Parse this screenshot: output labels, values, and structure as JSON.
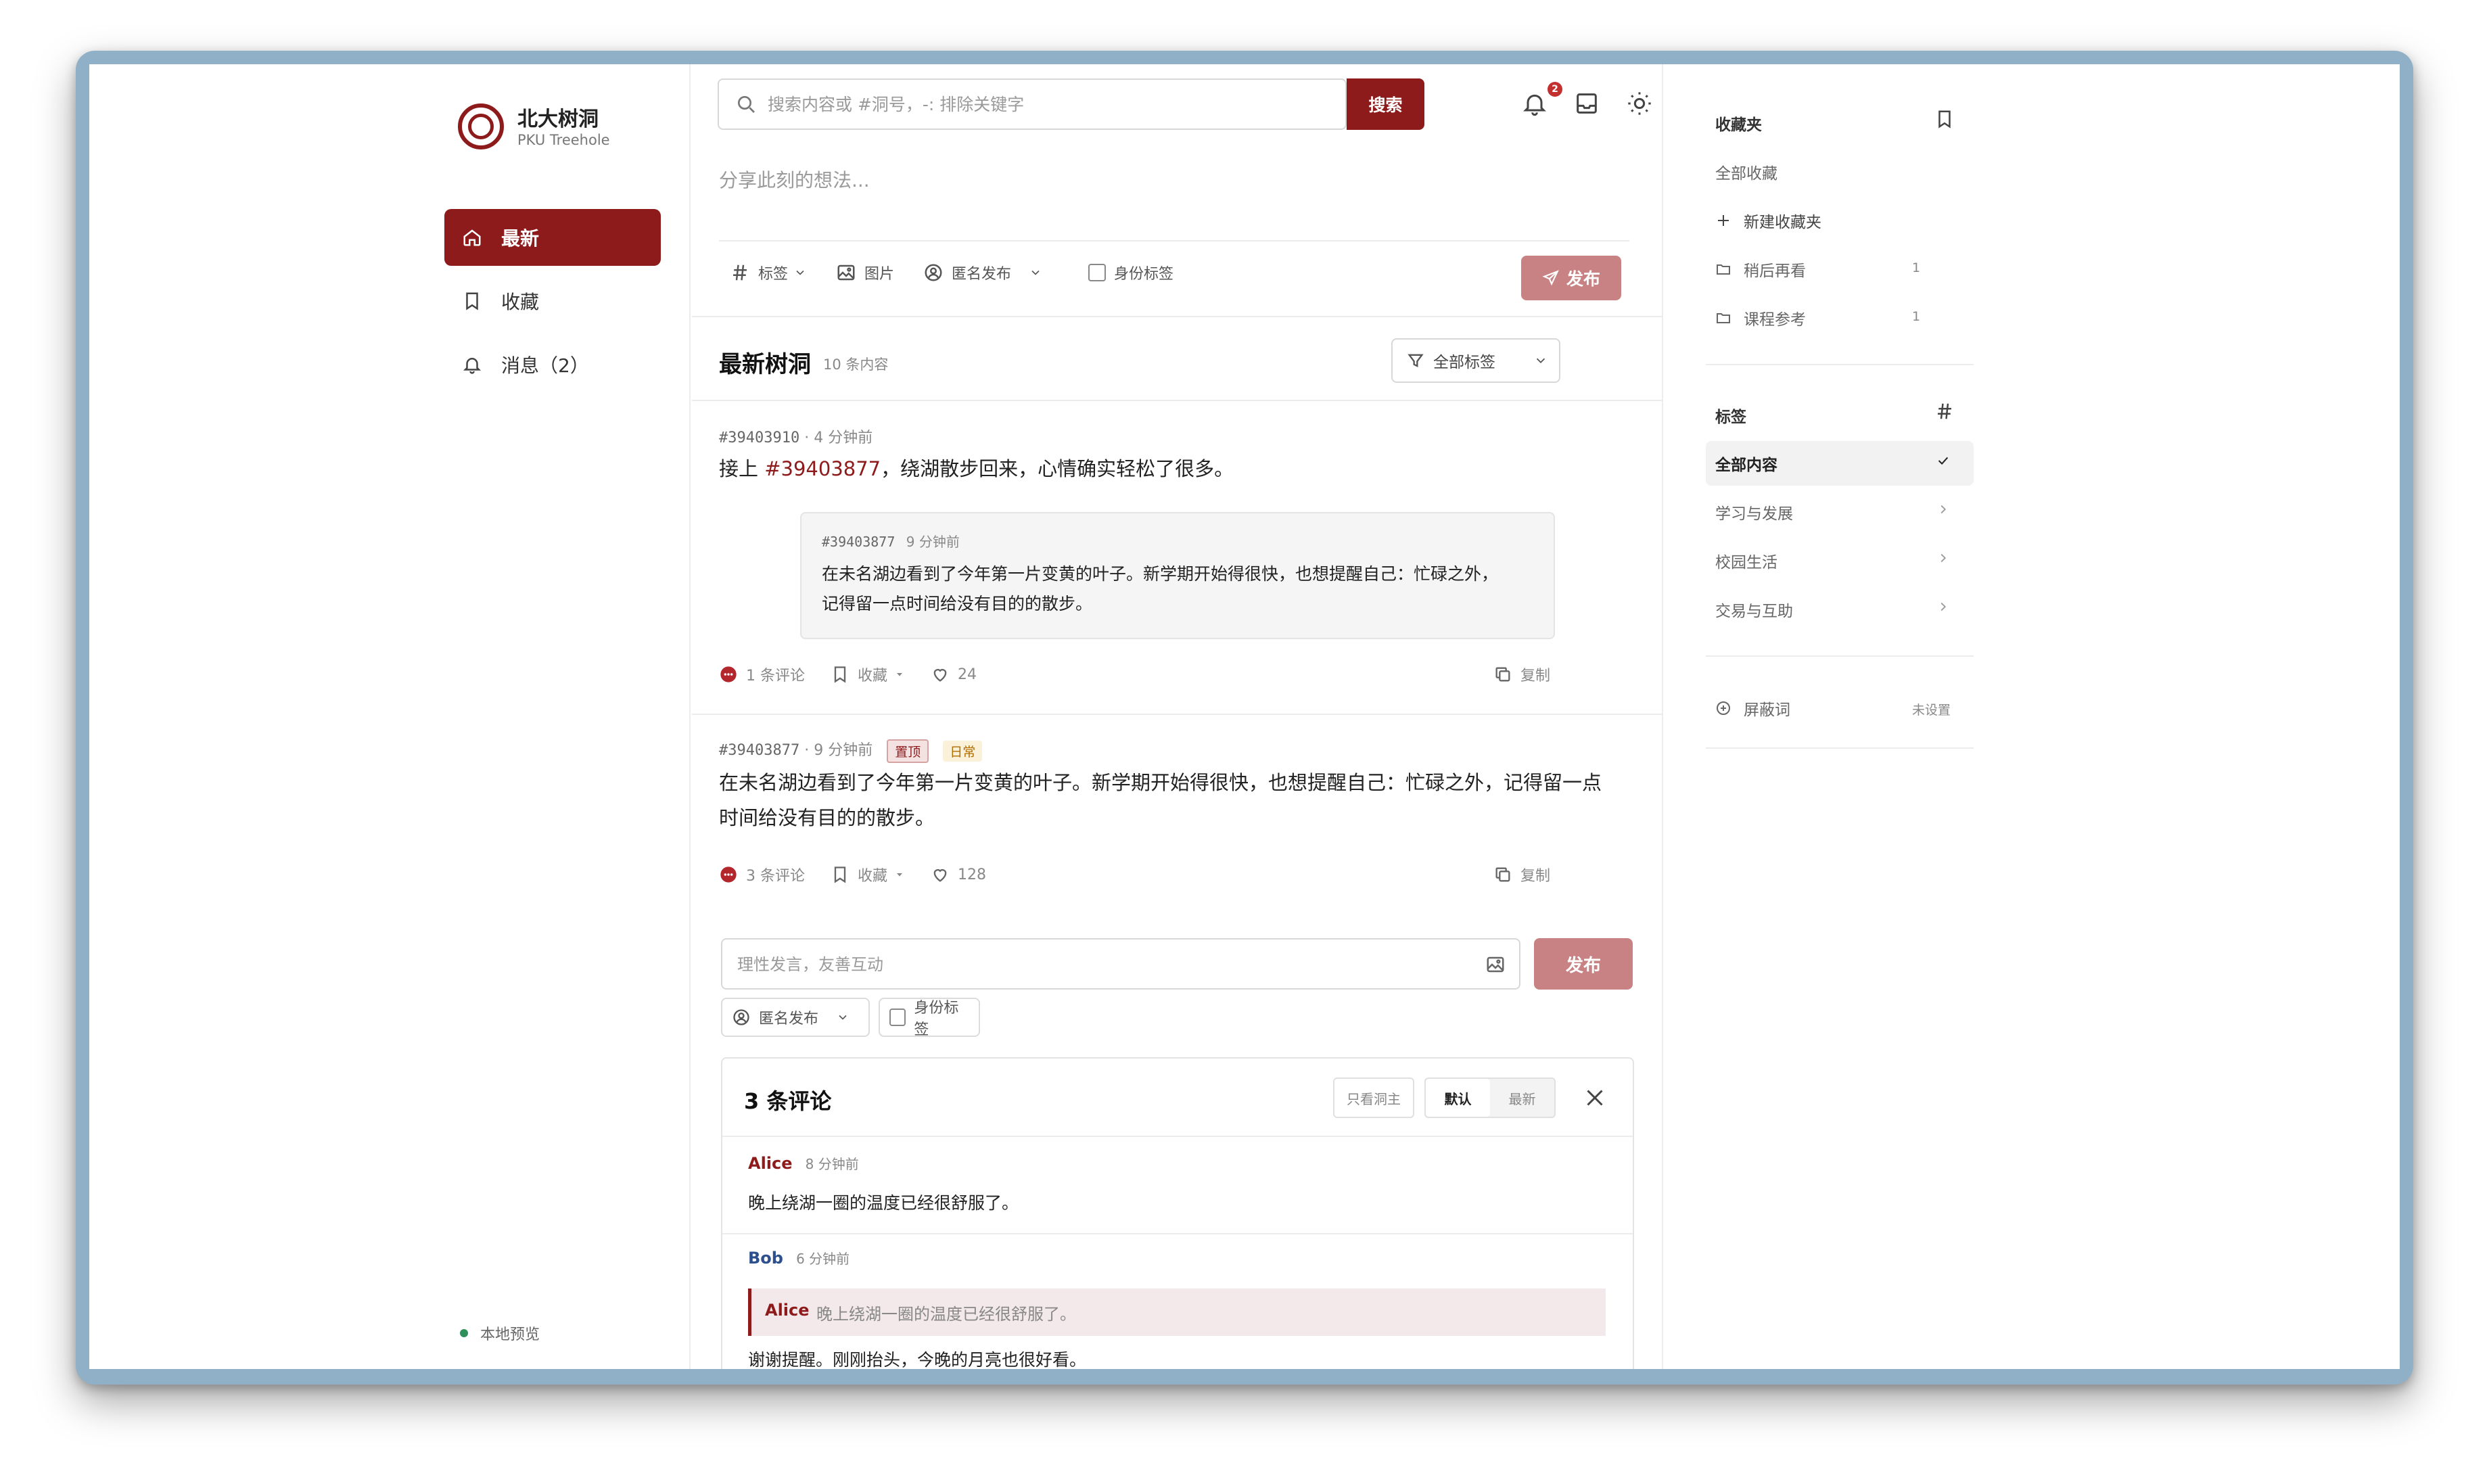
{
  "app": {
    "title": "北大树洞",
    "subtitle": "PKU Treehole",
    "status": "本地预览",
    "accent_color": "#8e1b1b"
  },
  "nav": {
    "items": [
      {
        "label": "最新",
        "icon": "home-icon",
        "active": true
      },
      {
        "label": "收藏",
        "icon": "bookmark-icon",
        "active": false
      },
      {
        "label": "消息（2）",
        "icon": "bell-icon",
        "active": false
      }
    ]
  },
  "toolbar": {
    "search_placeholder": "搜索内容或 #洞号，-: 排除关键字",
    "search_button": "搜索",
    "notification_count": "2"
  },
  "composer": {
    "placeholder": "分享此刻的想法...",
    "tag_label": "标签",
    "image_label": "图片",
    "anon_label": "匿名发布",
    "identity_label": "身份标签",
    "publish_label": "发布"
  },
  "feed": {
    "title": "最新树洞",
    "count": "10 条内容",
    "filter_label": "全部标签",
    "posts": [
      {
        "id": "#39403910",
        "time": "4 分钟前",
        "text_prefix": "接上 ",
        "ref": "#39403877",
        "text_suffix": "，绕湖散步回来，心情确实轻松了很多。",
        "quote": {
          "id": "#39403877",
          "time": "9 分钟前",
          "line1": "在未名湖边看到了今年第一片变黄的叶子。新学期开始得很快，也想提醒自己：忙碌之外，",
          "line2": "记得留一点时间给没有目的的散步。"
        },
        "comments": "1 条评论",
        "favorite": "收藏",
        "likes": "24",
        "copy": "复制"
      },
      {
        "id": "#39403877",
        "time": "9 分钟前",
        "tags": [
          "置顶",
          "日常"
        ],
        "line1": "在未名湖边看到了今年第一片变黄的叶子。新学期开始得很快，也想提醒自己：忙碌之外，记得留一点",
        "line2": "时间给没有目的的散步。",
        "comments": "3 条评论",
        "favorite": "收藏",
        "likes": "128",
        "copy": "复制"
      }
    ]
  },
  "reply": {
    "placeholder": "理性发言，友善互动",
    "publish_label": "发布",
    "anon_label": "匿名发布",
    "identity_label": "身份标签"
  },
  "comments_panel": {
    "title": "3 条评论",
    "only_op": "只看洞主",
    "sort_default": "默认",
    "sort_latest": "最新",
    "items": [
      {
        "author": "Alice",
        "time": "8 分钟前",
        "text": "晚上绕湖一圈的温度已经很舒服了。",
        "color": "#8e1b1b"
      },
      {
        "author": "Bob",
        "time": "6 分钟前",
        "quote_author": "Alice",
        "quote_text": "晚上绕湖一圈的温度已经很舒服了。",
        "text": "谢谢提醒。刚刚抬头，今晚的月亮也很好看。",
        "color": "#2c4f8e"
      }
    ]
  },
  "sidebar_right": {
    "favorites_title": "收藏夹",
    "all_favorites": "全部收藏",
    "new_folder": "新建收藏夹",
    "folders": [
      {
        "name": "稍后再看",
        "count": "1"
      },
      {
        "name": "课程参考",
        "count": "1"
      }
    ],
    "tags_title": "标签",
    "tags": [
      {
        "name": "全部内容",
        "selected": true
      },
      {
        "name": "学习与发展",
        "selected": false
      },
      {
        "name": "校园生活",
        "selected": false
      },
      {
        "name": "交易与互助",
        "selected": false
      }
    ],
    "block_words": "屏蔽词",
    "block_status": "未设置"
  }
}
